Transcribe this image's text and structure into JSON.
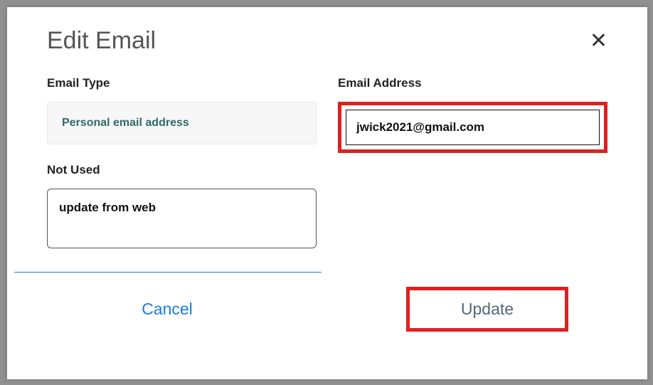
{
  "modal": {
    "title": "Edit Email",
    "close_label": "✕",
    "fields": {
      "email_type": {
        "label": "Email Type",
        "value": "Personal email address"
      },
      "email_address": {
        "label": "Email Address",
        "value": "jwick2021@gmail.com"
      },
      "not_used": {
        "label": "Not Used",
        "value": "update from web"
      }
    },
    "footer": {
      "cancel_label": "Cancel",
      "update_label": "Update"
    }
  },
  "highlight_color": "#e02020"
}
